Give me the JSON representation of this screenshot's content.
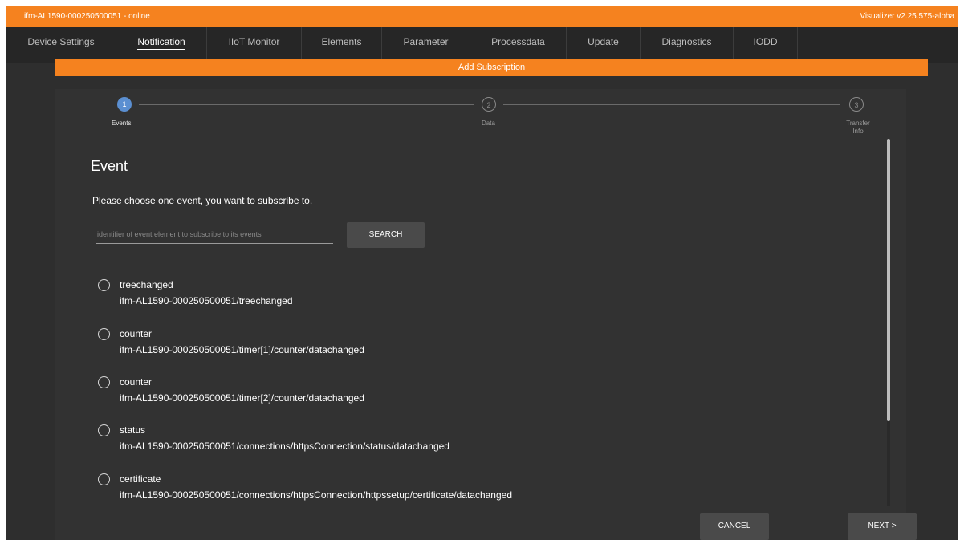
{
  "titlebar": {
    "device": "ifm-AL1590-000250500051 - online",
    "version": "Visualizer v2.25.575-alpha"
  },
  "tabs": [
    {
      "label": "Device Settings"
    },
    {
      "label": "Notification"
    },
    {
      "label": "IIoT Monitor"
    },
    {
      "label": "Elements"
    },
    {
      "label": "Parameter"
    },
    {
      "label": "Processdata"
    },
    {
      "label": "Update"
    },
    {
      "label": "Diagnostics"
    },
    {
      "label": "IODD"
    }
  ],
  "active_tab": "Notification",
  "banner": {
    "title": "Add Subscription"
  },
  "stepper": {
    "steps": [
      {
        "number": "1",
        "label": "Events",
        "state": "active"
      },
      {
        "number": "2",
        "label": "Data",
        "state": "todo"
      },
      {
        "number": "3",
        "label": "Transfer Info",
        "state": "todo"
      }
    ]
  },
  "content": {
    "heading": "Event",
    "instruction": "Please choose one event, you want to subscribe to.",
    "search_placeholder": "identifier of event element to subscribe to its events",
    "search_button": "SEARCH"
  },
  "events": [
    {
      "name": "treechanged",
      "path": "ifm-AL1590-000250500051/treechanged"
    },
    {
      "name": "counter",
      "path": "ifm-AL1590-000250500051/timer[1]/counter/datachanged"
    },
    {
      "name": "counter",
      "path": "ifm-AL1590-000250500051/timer[2]/counter/datachanged"
    },
    {
      "name": "status",
      "path": "ifm-AL1590-000250500051/connections/httpsConnection/status/datachanged"
    },
    {
      "name": "certificate",
      "path": "ifm-AL1590-000250500051/connections/httpsConnection/httpssetup/certificate/datachanged"
    }
  ],
  "footer": {
    "cancel": "CANCEL",
    "next": "NEXT >"
  },
  "colors": {
    "accent": "#f5821f",
    "background": "#2e2e2e",
    "step_active": "#5b8fd1"
  }
}
